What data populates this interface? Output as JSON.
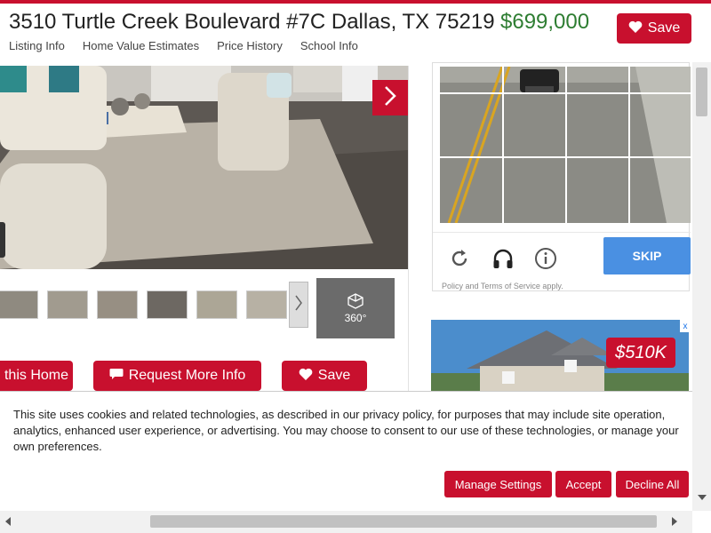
{
  "header": {
    "address": "3510 Turtle Creek Boulevard #7C Dallas, TX 75219",
    "price": "$699,000",
    "save_label": "Save",
    "tabs": [
      "Listing Info",
      "Home Value Estimates",
      "Price History",
      "School Info"
    ]
  },
  "gallery": {
    "tour_label": "360°",
    "thumbnail_count": 6
  },
  "actions": {
    "tour_label": "this Home",
    "request_label": "Request More Info",
    "save_label": "Save"
  },
  "captcha": {
    "skip_label": "SKIP",
    "policy_text": "Policy and Terms of Service apply."
  },
  "ad": {
    "badge": "$510K",
    "close_label": "x"
  },
  "cookie_banner": {
    "text": "This site uses cookies and related technologies, as described in our privacy policy, for purposes that may include site operation, analytics, enhanced user experience, or advertising. You may choose to consent to our use of these technologies, or manage your own preferences.",
    "manage_label": "Manage Settings",
    "accept_label": "Accept",
    "decline_label": "Decline All"
  },
  "colors": {
    "brand_red": "#c8102e",
    "price_green": "#2e7d32",
    "skip_blue": "#4a90e2"
  }
}
